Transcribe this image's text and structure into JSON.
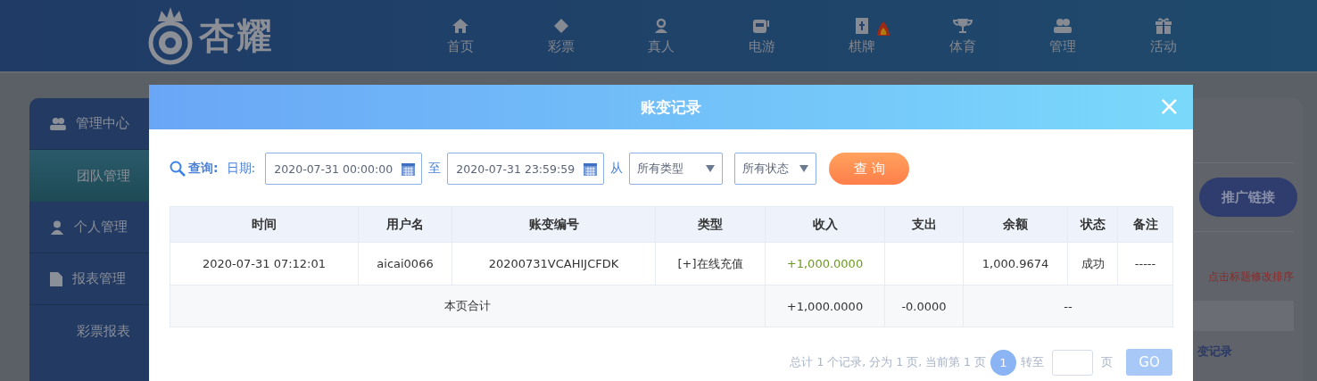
{
  "header": {
    "logo_text": "杏耀",
    "nav": [
      {
        "label": "首页",
        "hot": false
      },
      {
        "label": "彩票",
        "hot": false
      },
      {
        "label": "真人",
        "hot": false
      },
      {
        "label": "电游",
        "hot": false
      },
      {
        "label": "棋牌",
        "hot": true
      },
      {
        "label": "体育",
        "hot": false
      },
      {
        "label": "管理",
        "hot": false
      },
      {
        "label": "活动",
        "hot": false
      }
    ]
  },
  "sidebar": {
    "items": [
      {
        "label": "管理中心",
        "kind": "group",
        "selected": false
      },
      {
        "label": "团队管理",
        "kind": "sub",
        "selected": true
      },
      {
        "label": "个人管理",
        "kind": "group",
        "selected": false
      },
      {
        "label": "报表管理",
        "kind": "group",
        "selected": false
      },
      {
        "label": "彩票报表",
        "kind": "sub",
        "selected": false
      }
    ]
  },
  "right_panel": {
    "promo_button": "推广链接",
    "hint": "点击标题修改排序",
    "link": "变记录"
  },
  "modal": {
    "title": "账变记录",
    "close": "×",
    "filters": {
      "search_label": "查询:",
      "date_label": "日期:",
      "start": "2020-07-31 00:00:00",
      "to": "至",
      "end": "2020-07-31 23:59:59",
      "from": "从",
      "type_select": "所有类型",
      "status_select": "所有状态",
      "query_button": "查 询"
    },
    "table": {
      "columns": [
        "时间",
        "用户名",
        "账变编号",
        "类型",
        "收入",
        "支出",
        "余额",
        "状态",
        "备注"
      ],
      "rows": [
        [
          "2020-07-31 07:12:01",
          "aicai0066",
          "20200731VCAHIJCFDK",
          "[+]在线充值",
          "+1,000.0000",
          "",
          "1,000.9674",
          "成功",
          "-----"
        ]
      ],
      "total": {
        "label": "本页合计",
        "income": "+1,000.0000",
        "expense": "-0.0000",
        "balance": "--"
      }
    },
    "pagination": {
      "summary": "总计 1 个记录, 分为 1 页, 当前第 1 页",
      "pages": [
        {
          "label": "1",
          "selected": true
        }
      ],
      "goto": "转至",
      "unit": "页",
      "go": "GO"
    }
  }
}
